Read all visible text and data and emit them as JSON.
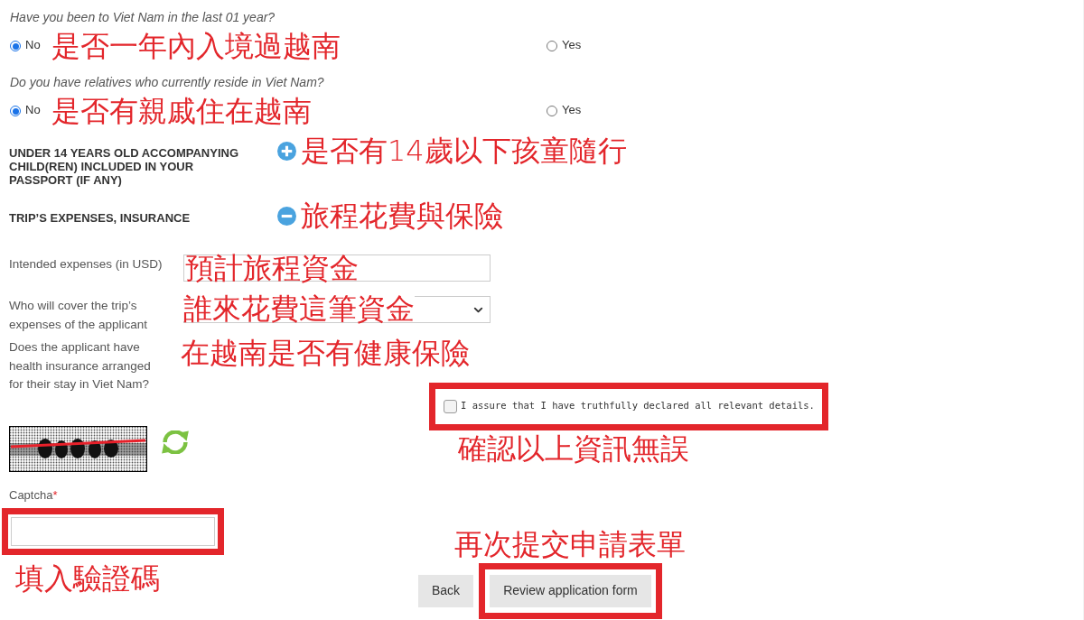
{
  "questions": [
    {
      "question": "Have you been to Viet Nam in the last 01 year?",
      "annotation": "是否一年內入境過越南",
      "options": [
        {
          "label": "No",
          "selected": true
        },
        {
          "label": "Yes",
          "selected": false
        }
      ]
    },
    {
      "question": "Do you have relatives who currently reside in Viet Nam?",
      "annotation": "是否有親戚住在越南",
      "options": [
        {
          "label": "No",
          "selected": true
        },
        {
          "label": "Yes",
          "selected": false
        }
      ]
    }
  ],
  "sections": [
    {
      "title": "UNDER 14 YEARS OLD ACCOMPANYING CHILD(REN) INCLUDED IN YOUR PASSPORT (IF ANY)",
      "expanded": false,
      "annotation": "是否有14歲以下孩童隨行"
    },
    {
      "title": "TRIP’S EXPENSES, INSURANCE",
      "expanded": true,
      "annotation": "旅程花費與保險"
    }
  ],
  "fields": [
    {
      "label": "Intended expenses (in USD)",
      "kind": "input",
      "annotation": "預計旅程資金"
    },
    {
      "label": "Who will cover the trip’s expenses of the applicant",
      "kind": "select",
      "annotation": "誰來花費這筆資金"
    },
    {
      "label": "Does the applicant have health insurance arranged for their stay in Viet Nam?",
      "kind": "blank",
      "annotation": "在越南是否有健康保險"
    }
  ],
  "declaration": {
    "label": "I assure that I have truthfully declared all relevant details.",
    "checked": false,
    "highlighted": true,
    "annotation": "確認以上資訊無誤"
  },
  "captcha": {
    "label": "Captcha",
    "required_mark": "*",
    "highlighted": true,
    "annotation": "填入驗證碼"
  },
  "buttons": [
    {
      "label": "Back",
      "highlighted": false
    },
    {
      "label": "Review application form",
      "highlighted": true,
      "annotation": "再次提交申請表單"
    }
  ]
}
